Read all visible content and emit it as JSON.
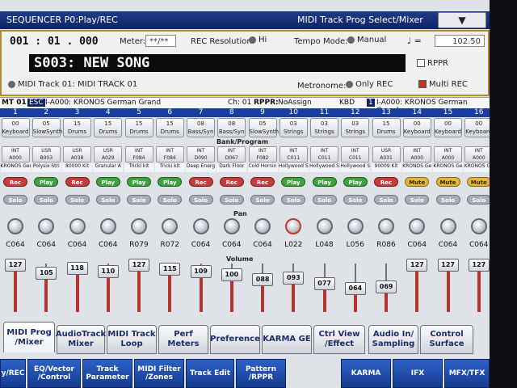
{
  "header": {
    "mode_title": "SEQUENCER P0:Play/REC",
    "page_title": "MIDI Track Prog Select/Mixer",
    "menu_icon": "chevron-down-icon"
  },
  "transport": {
    "location": "001 : 01 . 000",
    "meter_label": "Meter:",
    "meter_value": "**/**",
    "rec_resolution_label": "REC Resolution:",
    "rec_resolution_value": "Hi",
    "tempo_mode_label": "Tempo Mode:",
    "tempo_mode_value": "Manual",
    "tempo_label": "♩ =",
    "tempo_value": "102.50"
  },
  "song": {
    "name": "S003: NEW SONG",
    "rppr_checkbox": "RPPR",
    "rppr_checked": false,
    "track_select": "MIDI Track 01: MIDI TRACK 01",
    "metronome_label": "Metronome:",
    "metronome_value": "Only REC",
    "multi_rec": "Multi REC",
    "multi_rec_checked": true
  },
  "track_info": {
    "mt": "MT 01",
    "esc": "ESC",
    "program": "I-A000: KRONOS German Grand",
    "ch": "Ch: 01",
    "rppr": "RPPR:",
    "rppr_value": "NoAssign",
    "kbd_label": "KBD",
    "kbd_num": "1",
    "kbd_program": "I-A000: KRONOS German Grand"
  },
  "labels": {
    "bank_program": "Bank/Program",
    "pan": "Pan",
    "volume": "Volume"
  },
  "tracks": [
    {
      "num": "1",
      "cat_num": "00",
      "cat": "Keyboard",
      "bank_type": "INT",
      "bank_num": "A000",
      "program": "KRONOS German",
      "mode": "Rec",
      "mode_style": "rec",
      "solo": "Solo",
      "pan": "C064",
      "pan_red": false,
      "volume": "127",
      "vol_frac": 1.0
    },
    {
      "num": "2",
      "cat_num": "05",
      "cat": "SlowSynth",
      "bank_type": "USR",
      "bank_num": "B003",
      "program": "Polysix Stri",
      "mode": "Play",
      "mode_style": "play",
      "solo": "Solo",
      "pan": "C064",
      "pan_red": false,
      "volume": "105",
      "vol_frac": 0.827
    },
    {
      "num": "3",
      "cat_num": "15",
      "cat": "Drums",
      "bank_type": "USR",
      "bank_num": "A038",
      "program": "80000 Kit",
      "mode": "Rec",
      "mode_style": "rec",
      "solo": "Solo",
      "pan": "C064",
      "pan_red": false,
      "volume": "118",
      "vol_frac": 0.929
    },
    {
      "num": "4",
      "cat_num": "15",
      "cat": "Drums",
      "bank_type": "USR",
      "bank_num": "A029",
      "program": "Granular A",
      "mode": "Play",
      "mode_style": "play",
      "solo": "Solo",
      "pan": "C064",
      "pan_red": false,
      "volume": "110",
      "vol_frac": 0.866
    },
    {
      "num": "5",
      "cat_num": "15",
      "cat": "Drums",
      "bank_type": "INT",
      "bank_num": "F084",
      "program": "Tricki kit",
      "mode": "Play",
      "mode_style": "play",
      "solo": "Solo",
      "pan": "R079",
      "pan_red": false,
      "volume": "127",
      "vol_frac": 1.0
    },
    {
      "num": "6",
      "cat_num": "15",
      "cat": "Drums",
      "bank_type": "INT",
      "bank_num": "F084",
      "program": "Tricki kit",
      "mode": "Play",
      "mode_style": "play",
      "solo": "Solo",
      "pan": "R072",
      "pan_red": false,
      "volume": "115",
      "vol_frac": 0.906
    },
    {
      "num": "7",
      "cat_num": "08",
      "cat": "Bass/Syn",
      "bank_type": "INT",
      "bank_num": "D090",
      "program": "Deep Energ",
      "mode": "Rec",
      "mode_style": "rec",
      "solo": "Solo",
      "pan": "C064",
      "pan_red": false,
      "volume": "109",
      "vol_frac": 0.858
    },
    {
      "num": "8",
      "cat_num": "08",
      "cat": "Bass/Syn",
      "bank_type": "INT",
      "bank_num": "D067",
      "program": "Dark Floor",
      "mode": "Rec",
      "mode_style": "rec",
      "solo": "Solo",
      "pan": "C064",
      "pan_red": false,
      "volume": "100",
      "vol_frac": 0.787
    },
    {
      "num": "9",
      "cat_num": "05",
      "cat": "SlowSynth",
      "bank_type": "INT",
      "bank_num": "F082",
      "program": "Cold Hornin",
      "mode": "Rec",
      "mode_style": "rec",
      "solo": "Solo",
      "pan": "C064",
      "pan_red": false,
      "volume": "088",
      "vol_frac": 0.693
    },
    {
      "num": "10",
      "cat_num": "03",
      "cat": "Strings",
      "bank_type": "INT",
      "bank_num": "C011",
      "program": "Hollywood S",
      "mode": "Play",
      "mode_style": "play",
      "solo": "Solo",
      "pan": "L022",
      "pan_red": true,
      "volume": "093",
      "vol_frac": 0.732
    },
    {
      "num": "11",
      "cat_num": "03",
      "cat": "Strings",
      "bank_type": "INT",
      "bank_num": "C011",
      "program": "Hollywood S",
      "mode": "Play",
      "mode_style": "play",
      "solo": "Solo",
      "pan": "L048",
      "pan_red": false,
      "volume": "077",
      "vol_frac": 0.606
    },
    {
      "num": "12",
      "cat_num": "03",
      "cat": "Strings",
      "bank_type": "INT",
      "bank_num": "C011",
      "program": "Hollywood S",
      "mode": "Play",
      "mode_style": "play",
      "solo": "Solo",
      "pan": "L056",
      "pan_red": false,
      "volume": "064",
      "vol_frac": 0.504
    },
    {
      "num": "13",
      "cat_num": "15",
      "cat": "Drums",
      "bank_type": "USR",
      "bank_num": "A031",
      "program": "90009 Kit",
      "mode": "Rec",
      "mode_style": "rec",
      "solo": "Solo",
      "pan": "R086",
      "pan_red": false,
      "volume": "069",
      "vol_frac": 0.543
    },
    {
      "num": "14",
      "cat_num": "00",
      "cat": "Keyboard",
      "bank_type": "INT",
      "bank_num": "A000",
      "program": "KRONOS Ge",
      "mode": "Mute",
      "mode_style": "mute",
      "solo": "Solo",
      "pan": "C064",
      "pan_red": false,
      "volume": "127",
      "vol_frac": 1.0
    },
    {
      "num": "15",
      "cat_num": "00",
      "cat": "Keyboard",
      "bank_type": "INT",
      "bank_num": "A000",
      "program": "KRONOS Ge",
      "mode": "Mute",
      "mode_style": "mute",
      "solo": "Solo",
      "pan": "C064",
      "pan_red": false,
      "volume": "127",
      "vol_frac": 1.0
    },
    {
      "num": "16",
      "cat_num": "00",
      "cat": "Keyboard",
      "bank_type": "INT",
      "bank_num": "A000",
      "program": "KRONOS Ge",
      "mode": "Mute",
      "mode_style": "mute",
      "solo": "Solo",
      "pan": "C064",
      "pan_red": false,
      "volume": "127",
      "vol_frac": 1.0
    }
  ],
  "tabs_top": [
    {
      "label": "MIDI Prog /Mixer",
      "active": true
    },
    {
      "label": "AudioTrack Mixer",
      "active": false
    },
    {
      "label": "MIDI Track Loop",
      "active": false
    },
    {
      "label": "Perf Meters",
      "active": false
    },
    {
      "label": "Preference",
      "active": false
    },
    {
      "label": "KARMA GE",
      "active": false
    },
    {
      "label": "Ctrl View /Effect",
      "active": false
    },
    {
      "label": "Audio In/ Sampling",
      "active": false
    },
    {
      "label": "Control Surface",
      "active": false
    }
  ],
  "tabs_bottom": [
    {
      "label": "y/REC"
    },
    {
      "label": "EQ/Vector /Control"
    },
    {
      "label": "Track Parameter"
    },
    {
      "label": "MIDI Filter /Zones"
    },
    {
      "label": "Track Edit"
    },
    {
      "label": "Pattern /RPPR"
    },
    {
      "label": "KARMA"
    },
    {
      "label": "IFX"
    },
    {
      "label": "MFX/TFX"
    }
  ]
}
